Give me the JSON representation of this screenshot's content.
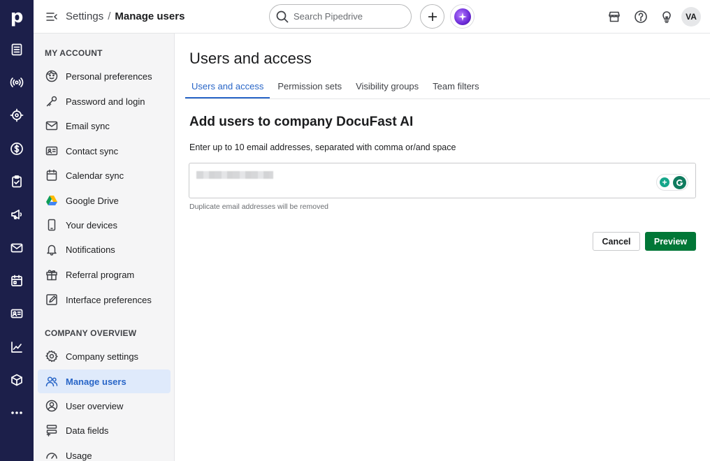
{
  "rail": {
    "logo": "p",
    "icons": [
      "deals-icon",
      "leads-icon",
      "projects-icon",
      "revenue-icon",
      "tasks-icon",
      "campaigns-icon",
      "mail-icon",
      "calendar-icon",
      "contacts-icon",
      "insights-icon",
      "products-icon",
      "more-icon"
    ]
  },
  "header": {
    "breadcrumb_parent": "Settings",
    "breadcrumb_separator": "/",
    "breadcrumb_current": "Manage users",
    "search_placeholder": "Search Pipedrive",
    "avatar_initials": "VA"
  },
  "sidebar": {
    "my_account_title": "MY ACCOUNT",
    "my_account_items": [
      {
        "label": "Personal preferences",
        "icon": "face-icon"
      },
      {
        "label": "Password and login",
        "icon": "key-icon"
      },
      {
        "label": "Email sync",
        "icon": "envelope-icon"
      },
      {
        "label": "Contact sync",
        "icon": "id-card-icon"
      },
      {
        "label": "Calendar sync",
        "icon": "calendar-icon"
      },
      {
        "label": "Google Drive",
        "icon": "google-drive-icon"
      },
      {
        "label": "Your devices",
        "icon": "phone-icon"
      },
      {
        "label": "Notifications",
        "icon": "bell-icon"
      },
      {
        "label": "Referral program",
        "icon": "gift-icon"
      },
      {
        "label": "Interface preferences",
        "icon": "edit-square-icon"
      }
    ],
    "company_title": "COMPANY OVERVIEW",
    "company_items": [
      {
        "label": "Company settings",
        "icon": "gear-icon"
      },
      {
        "label": "Manage users",
        "icon": "users-icon",
        "active": true
      },
      {
        "label": "User overview",
        "icon": "user-circle-icon"
      },
      {
        "label": "Data fields",
        "icon": "data-fields-icon"
      },
      {
        "label": "Usage",
        "icon": "gauge-icon"
      }
    ]
  },
  "main": {
    "title": "Users and access",
    "tabs": [
      {
        "label": "Users and access",
        "active": true
      },
      {
        "label": "Permission sets"
      },
      {
        "label": "Visibility groups"
      },
      {
        "label": "Team filters"
      }
    ],
    "section_heading": "Add users to company DocuFast AI",
    "instructions": "Enter up to 10 email addresses, separated with comma or/and space",
    "hint": "Duplicate email addresses will be removed",
    "cancel_label": "Cancel",
    "preview_label": "Preview"
  },
  "colors": {
    "rail_bg": "#1c1f4a",
    "accent_blue": "#2865c7",
    "active_bg": "#dfeafb",
    "primary_green": "#017737"
  }
}
